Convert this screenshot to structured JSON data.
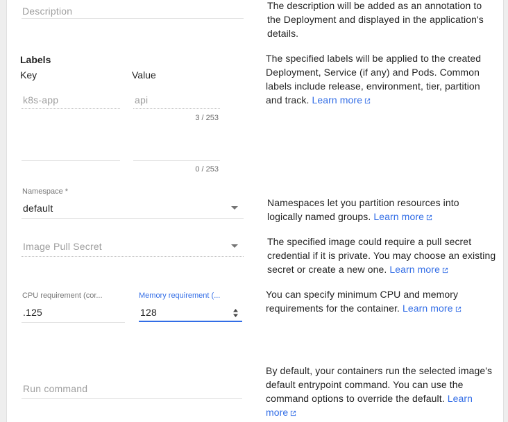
{
  "description": {
    "placeholder": "Description",
    "help": "The description will be added as an annotation to the Deployment and displayed in the application's details."
  },
  "labels": {
    "heading": "Labels",
    "key_header": "Key",
    "value_header": "Value",
    "rows": [
      {
        "key_placeholder": "k8s-app",
        "value_placeholder": "api",
        "counter": "3 / 253"
      },
      {
        "key_placeholder": "",
        "value_placeholder": "",
        "counter": "0 / 253"
      }
    ],
    "help": "The specified labels will be applied to the created Deployment, Service (if any) and Pods. Common labels include release, environment, tier, partition and track.",
    "learn_more": "Learn more"
  },
  "namespace": {
    "label": "Namespace *",
    "value": "default",
    "help": "Namespaces let you partition resources into logically named groups.",
    "learn_more": "Learn more"
  },
  "image_pull_secret": {
    "placeholder": "Image Pull Secret",
    "help": "The specified image could require a pull secret credential if it is private. You may choose an existing secret or create a new one.",
    "learn_more": "Learn more"
  },
  "cpu": {
    "label": "CPU requirement (cor...",
    "value": ".125"
  },
  "memory": {
    "label": "Memory requirement (...",
    "value": "128"
  },
  "resources_help": {
    "help": "You can specify minimum CPU and memory requirements for the container.",
    "learn_more": "Learn more"
  },
  "run_command": {
    "placeholder": "Run command",
    "help": "By default, your containers run the selected image's default entrypoint command. You can use the command options to override the default.",
    "learn_more": "Learn more"
  },
  "colors": {
    "accent": "#326de6",
    "background": "#eeeeee",
    "card": "#ffffff"
  }
}
